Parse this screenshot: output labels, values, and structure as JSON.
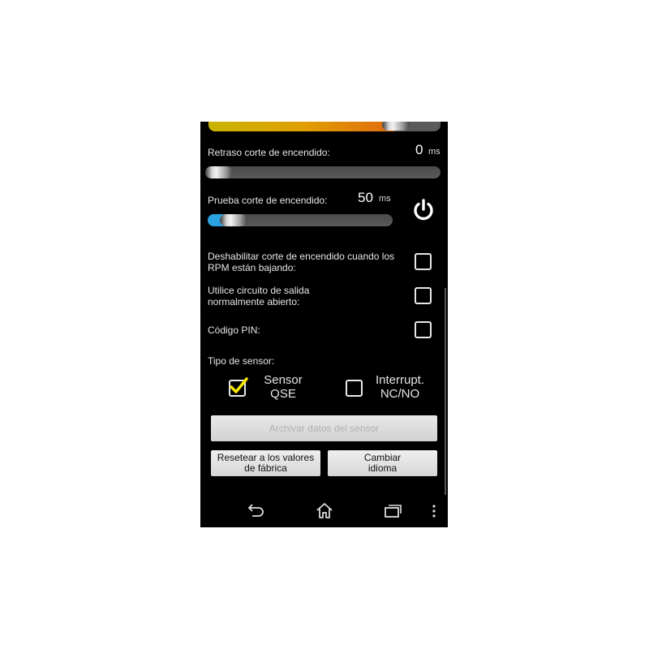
{
  "settings": {
    "delay": {
      "label": "Retraso corte de encendido:",
      "value": "0",
      "unit": "ms",
      "slider_fraction": 0.0
    },
    "test": {
      "label": "Prueba corte de encendido:",
      "value": "50",
      "unit": "ms",
      "slider_fraction": 0.09
    },
    "disable_rpm_drop": {
      "label": "Deshabilitar corte de encendido cuando los RPM están bajando:",
      "checked": false
    },
    "normally_open": {
      "label": "Utilice circuito de salida normalmente abierto:",
      "checked": false
    },
    "pin_code": {
      "label": "Código PIN:",
      "checked": false
    },
    "sensor_type": {
      "label": "Tipo de sensor:",
      "options": [
        {
          "label_line1": "Sensor",
          "label_line2": "QSE",
          "checked": true
        },
        {
          "label_line1": "Interrupt.",
          "label_line2": "NC/NO",
          "checked": false
        }
      ]
    }
  },
  "buttons": {
    "save_sensor": "Archivar datos del sensor",
    "factory_reset": "Resetear a los valores de fábrica",
    "change_language": "Cambiar idioma"
  },
  "icons": {
    "power": "power-icon",
    "back": "back-icon",
    "home": "home-icon",
    "recents": "recent-apps-icon",
    "menu": "overflow-menu-icon"
  },
  "colors": {
    "accent": "#2aa3e0",
    "check": "#f5e600",
    "background": "#000000"
  }
}
